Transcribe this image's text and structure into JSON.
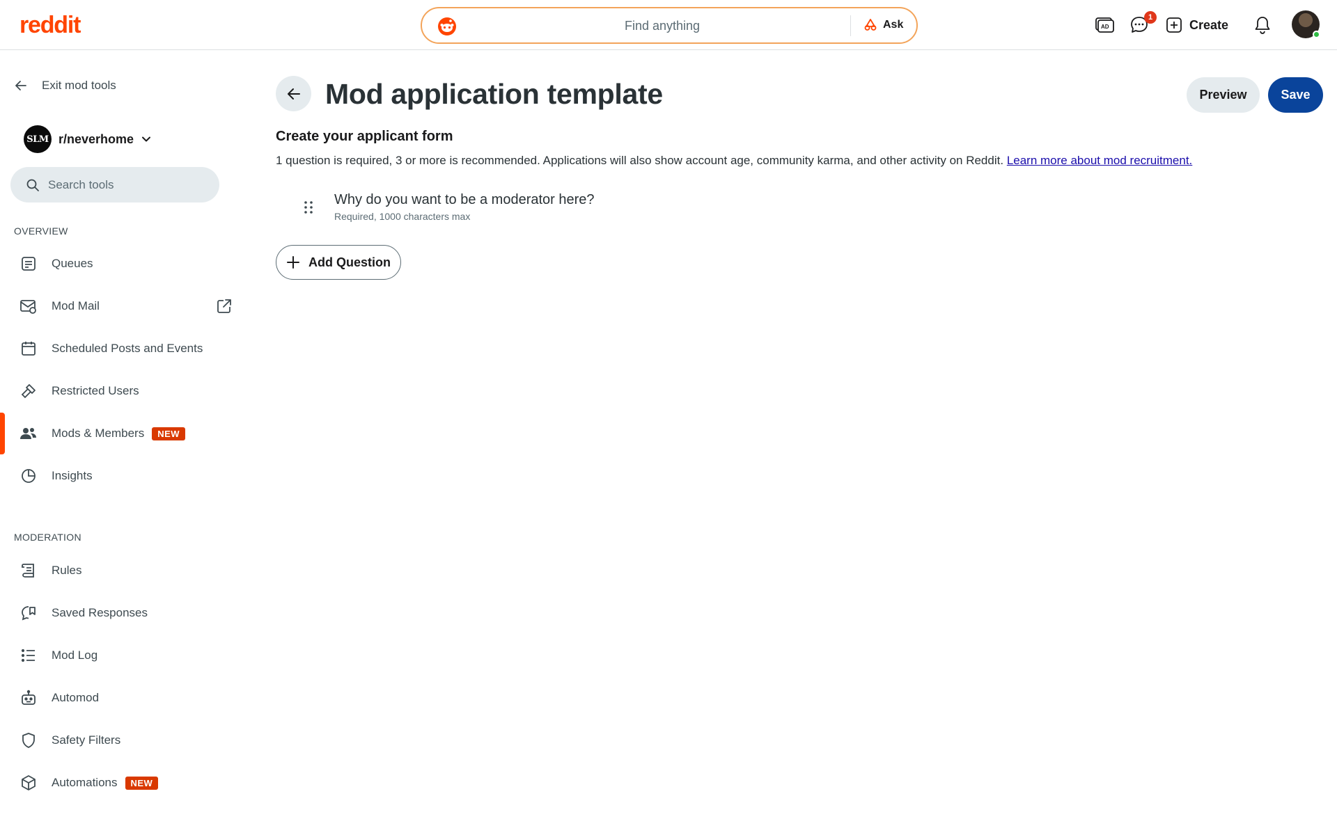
{
  "header": {
    "logo": "reddit",
    "search_placeholder": "Find anything",
    "ask_label": "Ask",
    "chat_count": "1",
    "create_label": "Create"
  },
  "sidebar": {
    "exit_label": "Exit mod tools",
    "subreddit": "r/neverhome",
    "subreddit_avatar_text": "SLM",
    "search_placeholder": "Search tools",
    "overview_title": "OVERVIEW",
    "overview_items": [
      {
        "label": "Queues",
        "icon": "queue-icon"
      },
      {
        "label": "Mod Mail",
        "icon": "mail-icon"
      },
      {
        "label": "Scheduled Posts and Events",
        "icon": "calendar-icon"
      },
      {
        "label": "Restricted Users",
        "icon": "gavel-icon"
      },
      {
        "label": "Mods & Members",
        "icon": "members-icon",
        "badge": "NEW",
        "active": true
      },
      {
        "label": "Insights",
        "icon": "chart-icon"
      }
    ],
    "moderation_title": "MODERATION",
    "moderation_items": [
      {
        "label": "Rules",
        "icon": "rules-icon"
      },
      {
        "label": "Saved Responses",
        "icon": "saved-responses-icon"
      },
      {
        "label": "Mod Log",
        "icon": "list-icon"
      },
      {
        "label": "Automod",
        "icon": "robot-icon"
      },
      {
        "label": "Safety Filters",
        "icon": "shield-icon"
      },
      {
        "label": "Automations",
        "icon": "cube-icon",
        "badge": "NEW"
      }
    ]
  },
  "main": {
    "title": "Mod application template",
    "preview_label": "Preview",
    "save_label": "Save",
    "form_title": "Create your applicant form",
    "form_description": "1 question is required, 3 or more is recommended. Applications will also show account age, community karma, and other activity on Reddit.",
    "learn_more_link": "Learn more about mod recruitment.",
    "questions": [
      {
        "text": "Why do you want to be a moderator here?",
        "meta": "Required, 1000 characters max"
      }
    ],
    "add_question_label": "Add Question"
  },
  "colors": {
    "brand": "#ff4500",
    "primary_button": "#0a449b",
    "new_badge": "#d93900",
    "link": "#1a0dab"
  }
}
